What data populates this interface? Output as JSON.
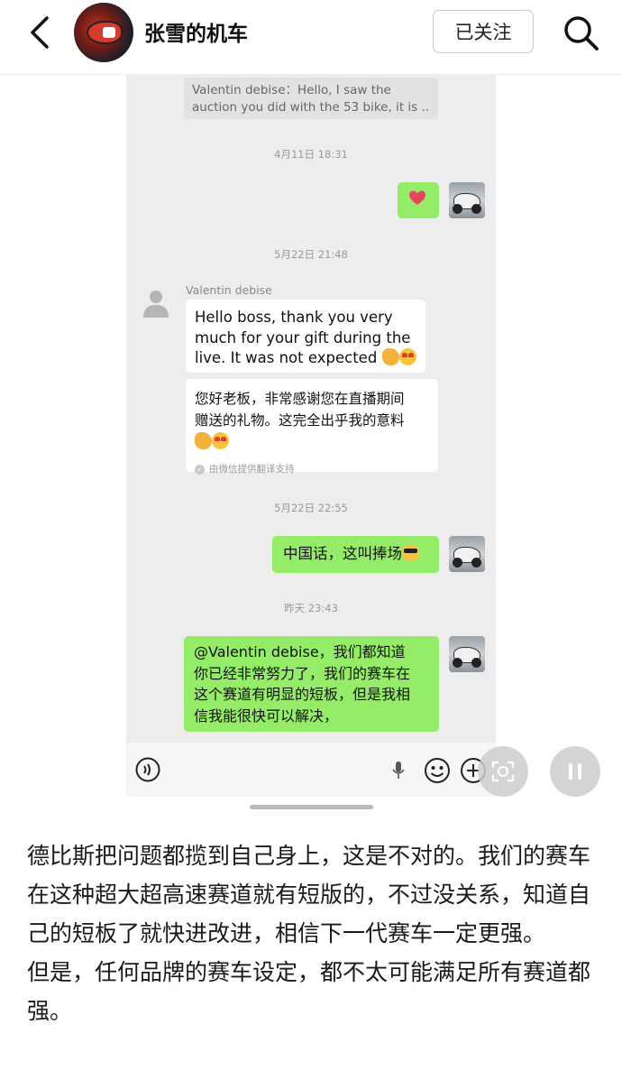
{
  "header": {
    "username": "张雪的机车",
    "follow_label": "已关注"
  },
  "chat": {
    "quote_line1": "Valentin debise：Hello, I saw the",
    "quote_line2": "auction you did with the 53 bike, it is ...",
    "timestamps": [
      "4月11日 18:31",
      "5月22日 21:48",
      "5月22日 22:55",
      "昨天 23:43"
    ],
    "sender_name": "Valentin debise",
    "msg_en_1": "Hello boss, thank you very",
    "msg_en_2": "much for your gift during the",
    "msg_en_3": "live. It was not expected",
    "translation_1": "您好老板，非常感谢您在直播期间",
    "translation_2": "赠送的礼物。这完全出乎我的意料",
    "translation_note": "由微信提供翻译支持",
    "reply_1": "中国话，这叫捧场",
    "reply_2_line1": "@Valentin debise，我们都知道",
    "reply_2_line2": "你已经非常努力了，我们的赛车在",
    "reply_2_line3": "这个赛道有明显的短板，但是我相",
    "reply_2_line4": "信我能很快可以解决，"
  },
  "caption": {
    "para1": "德比斯把问题都揽到自己身上，这是不对的。我们的赛车在这种超大超高速赛道就有短版的，不过没关系，知道自己的短板了就快进改进，相信下一代赛车一定更强。",
    "para2": "但是，任何品牌的赛车设定，都不太可能满足所有赛道都强。"
  },
  "colors": {
    "green_bubble": "#95ec69",
    "chat_bg": "#ededed",
    "heart": "#e8445a"
  },
  "icons": [
    "back-arrow-icon",
    "search-icon",
    "voice-icon",
    "mic-icon",
    "emoji-icon",
    "plus-icon",
    "scan-icon",
    "pause-icon",
    "default-avatar-icon"
  ]
}
